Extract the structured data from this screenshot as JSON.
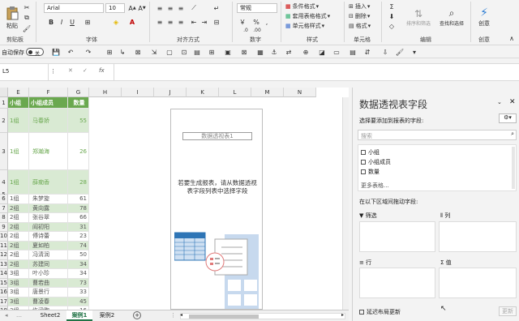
{
  "ribbon": {
    "paste": "粘贴",
    "clipboard": "剪贴板",
    "font_name": "Arial",
    "font_size": "10",
    "bold": "B",
    "italic": "I",
    "underline": "U",
    "font_group": "字体",
    "align_group": "对齐方式",
    "number_format": "常规",
    "percent": "%",
    "number_group": "数字",
    "cond_format": "条件格式",
    "table_format": "套用表格格式",
    "cell_style": "单元格样式",
    "style_group": "样式",
    "insert": "插入",
    "delete": "删除",
    "format": "格式",
    "cells_group": "单元格",
    "sort_filter": "排序和筛选",
    "find_select": "查找和选择",
    "edit_group": "编辑",
    "create": "创意",
    "create_group": "创意"
  },
  "qat": {
    "autosave": "自动保存",
    "toggle": "关"
  },
  "formula_bar": {
    "name_box": "L5",
    "fx": "fx",
    "value": ""
  },
  "columns": [
    "E",
    "F",
    "G",
    "H",
    "I",
    "J",
    "K",
    "L",
    "M",
    "N"
  ],
  "table": {
    "headers": [
      "小组",
      "小组成员",
      "数量"
    ],
    "rows": [
      {
        "row": "2",
        "group": "1组",
        "member": "马春娇",
        "qty": "55"
      },
      {
        "row": "3",
        "group": "1组",
        "member": "郑瀚海",
        "qty": "26"
      },
      {
        "row": "4",
        "group": "1组",
        "member": "薛痴香",
        "qty": "28"
      },
      {
        "row": "6",
        "group": "1组",
        "member": "朱梦旋",
        "qty": "61"
      },
      {
        "row": "7",
        "group": "2组",
        "member": "黄向露",
        "qty": "78"
      },
      {
        "row": "8",
        "group": "2组",
        "member": "张谷翠",
        "qty": "66"
      },
      {
        "row": "9",
        "group": "2组",
        "member": "阎初阳",
        "qty": "31"
      },
      {
        "row": "10",
        "group": "2组",
        "member": "傅诗蕾",
        "qty": "23"
      },
      {
        "row": "11",
        "group": "2组",
        "member": "夏如柏",
        "qty": "74"
      },
      {
        "row": "12",
        "group": "2组",
        "member": "冯清润",
        "qty": "50"
      },
      {
        "row": "13",
        "group": "2组",
        "member": "苏建同",
        "qty": "34"
      },
      {
        "row": "14",
        "group": "3组",
        "member": "叶小珍",
        "qty": "34"
      },
      {
        "row": "15",
        "group": "3组",
        "member": "曹若曲",
        "qty": "73"
      },
      {
        "row": "16",
        "group": "3组",
        "member": "唐景行",
        "qty": "33"
      },
      {
        "row": "17",
        "group": "3组",
        "member": "曹凌春",
        "qty": "45"
      },
      {
        "row": "18",
        "group": "3组",
        "member": "许涵煦",
        "qty": "16"
      }
    ]
  },
  "pivot_placeholder": {
    "title": "数据透视表1",
    "hint": "若要生成报表，请从数据透视表字段列表中选择字段"
  },
  "sheet_tabs": [
    "Sheet2",
    "案例1",
    "案例2"
  ],
  "active_tab": "案例1",
  "pane": {
    "title": "数据透视表字段",
    "subtitle": "选择要添加到报表的字段:",
    "search_placeholder": "搜索",
    "fields": [
      "小组",
      "小组成员",
      "数量"
    ],
    "more_tables": "更多表格...",
    "drag_hint": "在以下区域间拖动字段:",
    "filter": "筛选",
    "columns": "列",
    "rows": "行",
    "values": "值",
    "defer": "延迟布局更新",
    "update": "更新"
  },
  "colors": {
    "table_green": "#6aa84f",
    "light_green": "#d9ead3",
    "accent": "#217346"
  }
}
